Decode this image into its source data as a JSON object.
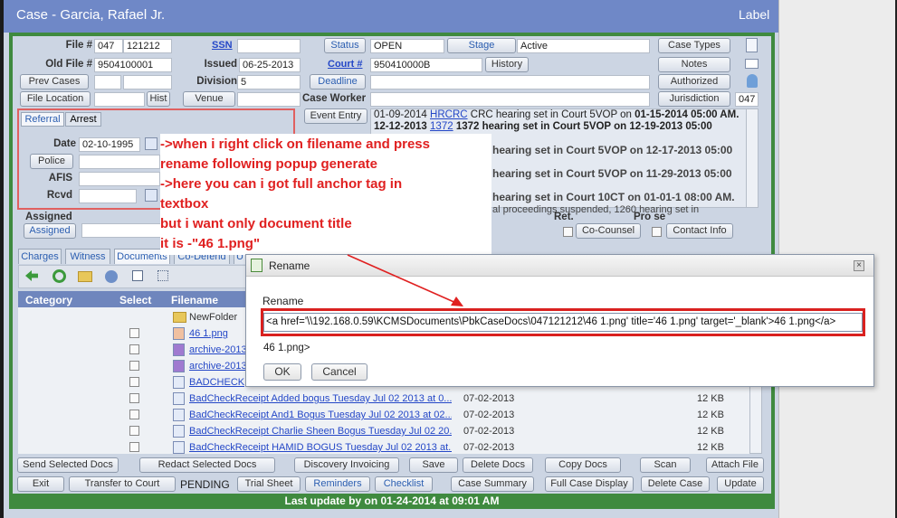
{
  "window": {
    "title": "Case - Garcia, Rafael Jr.",
    "label_btn": "Label"
  },
  "header": {
    "file_label": "File #",
    "file_a": "047",
    "file_b": "121212",
    "ssn_label": "SSN",
    "oldfile_label": "Old File #",
    "oldfile": "9504100001",
    "issued_label": "Issued",
    "issued": "06-25-2013",
    "prev_cases": "Prev Cases",
    "division_label": "Division",
    "division": "5",
    "file_location": "File Location",
    "hist": "Hist",
    "venue": "Venue",
    "status_btn": "Status",
    "status": "OPEN",
    "stage_btn": "Stage",
    "stage": "Active",
    "court_label": "Court #",
    "court": "950410000B",
    "history": "History",
    "deadline": "Deadline",
    "case_worker": "Case Worker",
    "event_entry": "Event Entry",
    "case_types": "Case Types",
    "notes": "Notes",
    "authorized": "Authorized",
    "jurisdiction": "Jurisdiction",
    "jurisdiction_val": "047"
  },
  "referral": {
    "tab1": "Referral",
    "tab2": "Arrest",
    "date_label": "Date",
    "date": "02-10-1995",
    "police": "Police",
    "afis": "AFIS",
    "rcvd": "Rcvd"
  },
  "events": {
    "l1a": "01-09-2014",
    "l1link": "HRCRC",
    "l1b": "CRC hearing set in Court 5VOP on",
    "l1c": "01-15-2014 05:00 AM.",
    "l2a": "12-12-2013",
    "l2link": "1372",
    "l2b": "1372 hearing set in Court 5VOP on",
    "l2c": "12-19-2013 05:00",
    "l3": "hearing set in Court 5VOP on 12-17-2013 05:00",
    "l4": "hearing set in Court 5VOP on 11-29-2013 05:00",
    "l5": "hearing set in Court 10CT on 01-01-1 08:00 AM.",
    "l6": "al proceedings suspended, 1260 hearing set in"
  },
  "assigned": {
    "label": "Assigned",
    "btn": "Assigned",
    "ret": "Ret.",
    "prose": "Pro se",
    "co_counsel": "Co-Counsel",
    "contact": "Contact Info"
  },
  "tabs": [
    "Charges",
    "Witness",
    "Documents",
    "Co-Defend",
    "U"
  ],
  "docs": {
    "col_category": "Category",
    "col_select": "Select",
    "col_filename": "Filename",
    "rows": [
      {
        "name": "NewFolder",
        "date": "",
        "size": ""
      },
      {
        "name": "46 1.png",
        "date": "",
        "size": ""
      },
      {
        "name": "archive-2013",
        "date": "",
        "size": ""
      },
      {
        "name": "archive-2013",
        "date": "",
        "size": ""
      },
      {
        "name": "BADCHECK",
        "date": "",
        "size": ""
      },
      {
        "name": "BadCheckReceipt Added bogus Tuesday Jul 02 2013 at 0...",
        "date": "07-02-2013",
        "size": "12 KB"
      },
      {
        "name": "BadCheckReceipt And1 Bogus Tuesday Jul 02 2013 at 02...",
        "date": "07-02-2013",
        "size": "12 KB"
      },
      {
        "name": "BadCheckReceipt Charlie Sheen Bogus Tuesday Jul 02 20...",
        "date": "07-02-2013",
        "size": "12 KB"
      },
      {
        "name": "BadCheckReceipt HAMID BOGUS Tuesday Jul 02 2013 at...",
        "date": "07-02-2013",
        "size": "12 KB"
      }
    ]
  },
  "bottom": {
    "send": "Send Selected Docs",
    "redact": "Redact Selected Docs",
    "discovery": "Discovery Invoicing",
    "save": "Save",
    "delete_docs": "Delete Docs",
    "copy_docs": "Copy Docs",
    "scan": "Scan",
    "attach": "Attach File",
    "exit": "Exit",
    "transfer": "Transfer to Court",
    "pending": "PENDING",
    "trial": "Trial Sheet",
    "reminders": "Reminders",
    "checklist": "Checklist",
    "summary": "Case Summary",
    "full": "Full Case Display",
    "delete_case": "Delete Case",
    "update": "Update",
    "status_line": "Last update by on 01-24-2014 at 09:01 AM"
  },
  "annotation": {
    "l1": "->when i right click on filename and press",
    "l2": "rename following popup generate",
    "l3": "->here you can i got full anchor tag in",
    "l4": "textbox",
    "l5": "but i want only document title",
    "l6": "it is -\"46 1.png\""
  },
  "dialog": {
    "title": "Rename",
    "field_label": "Rename",
    "value": "<a href='\\\\192.168.0.59\\KCMSDocuments\\PbkCaseDocs\\047121212\\46 1.png' title='46 1.png' target='_blank'>46 1.png</a>",
    "tail": "46 1.png>",
    "ok": "OK",
    "cancel": "Cancel"
  },
  "colors": {
    "annotation": "#e02020",
    "highlight": "#d9211f",
    "frame_green": "#3f8a3f",
    "titlebar": "#6f88c7"
  }
}
